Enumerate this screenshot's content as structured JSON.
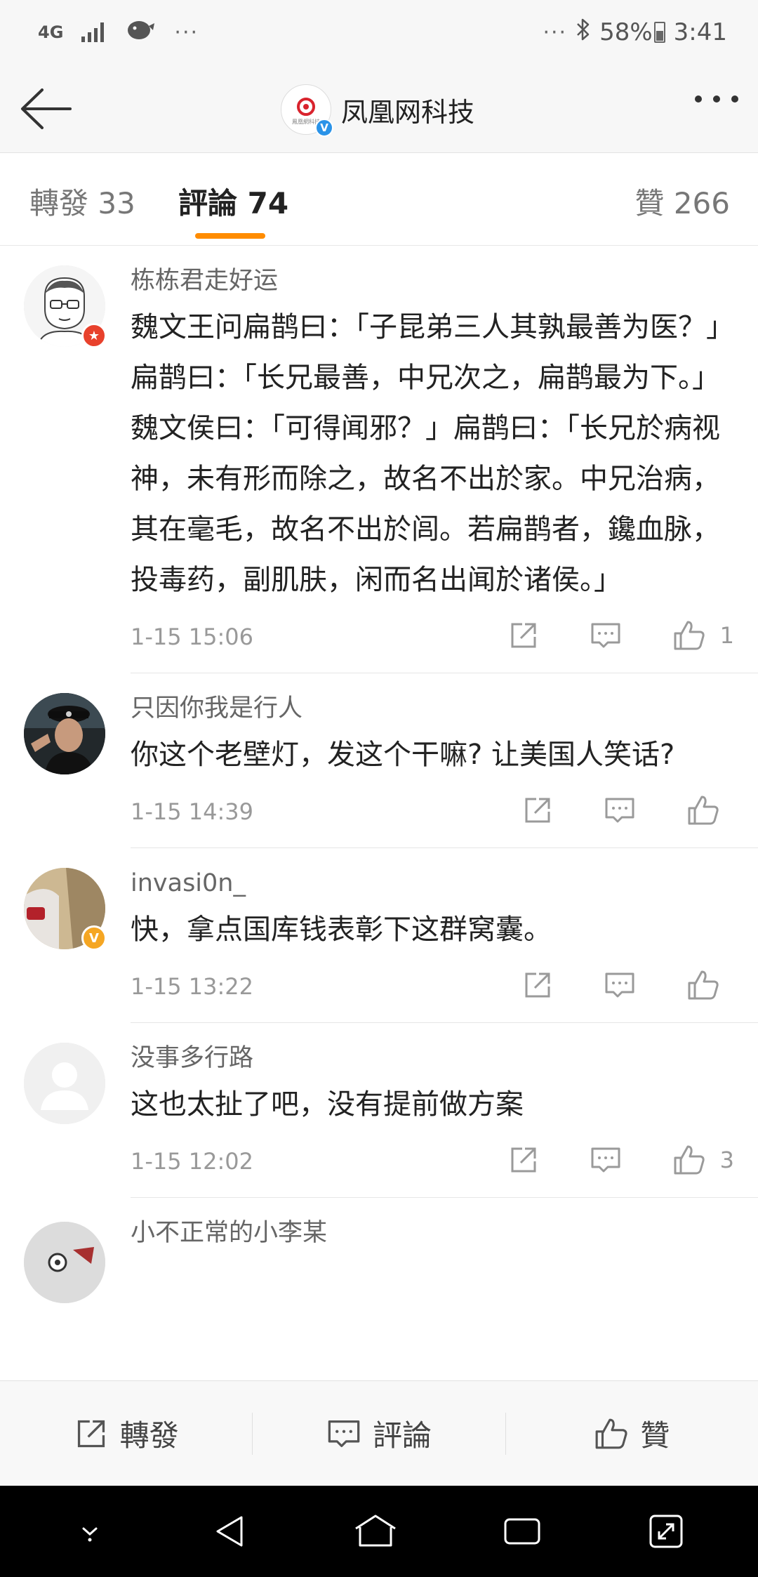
{
  "status_bar": {
    "network": "4G",
    "battery": "58%",
    "time": "3:41",
    "overflow_dots": "···"
  },
  "nav": {
    "title": "凤凰网科技",
    "avatar_text": "鳳凰網科技",
    "verified": "V"
  },
  "tabs": {
    "repost": "轉發 33",
    "comment": "評論 74",
    "like": "贊 266"
  },
  "comments": [
    {
      "name": "栋栋君走好运",
      "text": "魏文王问扁鹊曰：「子昆弟三人其孰最善为医？」扁鹊曰：「长兄最善，中兄次之，扁鹊最为下。」魏文侯曰：「可得闻邪？」扁鹊曰：「长兄於病视神，未有形而除之，故名不出於家。中兄治病，其在毫毛，故名不出於闾。若扁鹊者，鑱血脉，投毒药，副肌肤，闲而名出闻於诸侯。」",
      "time": "1-15 15:06",
      "likes": "1",
      "badge": "★",
      "badge_color": "#e8412c"
    },
    {
      "name": "只因你我是行人",
      "text": "你这个老壁灯，发这个干嘛? 让美国人笑话?",
      "time": "1-15 14:39",
      "likes": ""
    },
    {
      "name": "invasi0n_",
      "text": "快，拿点国库钱表彰下这群窝囊。",
      "time": "1-15 13:22",
      "likes": "",
      "badge": "V",
      "badge_color": "#f5a623"
    },
    {
      "name": "没事多行路",
      "text": "这也太扯了吧，没有提前做方案",
      "time": "1-15 12:02",
      "likes": "3"
    },
    {
      "name": "小不正常的小李某",
      "text": "",
      "time": "",
      "likes": ""
    }
  ],
  "bottom_bar": {
    "repost": "轉發",
    "comment": "評論",
    "like": "贊"
  },
  "colors": {
    "accent": "#ff8c00",
    "verified_blue": "#2a93e8"
  }
}
